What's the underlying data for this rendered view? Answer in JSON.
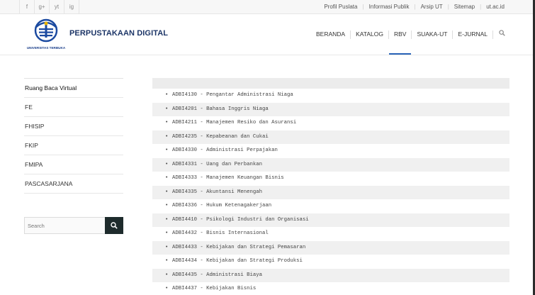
{
  "topbar": {
    "social": [
      "f",
      "g+",
      "yt",
      "ig"
    ],
    "links": [
      "Profil Puslata",
      "Informasi Publik",
      "Arsip UT",
      "Sitemap",
      "ut.ac.id"
    ]
  },
  "header": {
    "logo_text": "UNIVERSITAS TERBUKA",
    "site_title": "PERPUSTAKAAN DIGITAL",
    "nav": [
      "BERANDA",
      "KATALOG",
      "RBV",
      "SUAKA-UT",
      "E-JURNAL"
    ],
    "active_nav": "RBV"
  },
  "sidebar": {
    "items": [
      "Ruang Baca Virtual",
      "FE",
      "FHISIP",
      "FKIP",
      "FMIPA",
      "PASCASARJANA"
    ],
    "search_placeholder": "Search"
  },
  "courses": [
    "ADBI4130 - Pengantar Administrasi Niaga",
    "ADBI4201 - Bahasa Inggris Niaga",
    "ADBI4211 - Manajemen Resiko dan Asuransi",
    "ADBI4235 - Kepabeanan dan Cukai",
    "ADBI4330 - Administrasi Perpajakan",
    "ADBI4331 - Uang dan Perbankan",
    "ADBI4333 - Manajemen Keuangan Bisnis",
    "ADBI4335 - Akuntansi Menengah",
    "ADBI4336 - Hukum Ketenagakerjaan",
    "ADBI4410 - Psikologi Industri dan Organisasi",
    "ADBI4432 - Bisnis Internasional",
    "ADBI4433 - Kebijakan dan Strategi Pemasaran",
    "ADBI4434 - Kebijakan dan Strategi Produksi",
    "ADBI4435 - Administrasi Biaya",
    "ADBI4437 - Kebijakan Bisnis"
  ],
  "colors": {
    "brand": "#1c3567",
    "active_underline": "#2a64b8",
    "search_button": "#1e2b2c"
  }
}
